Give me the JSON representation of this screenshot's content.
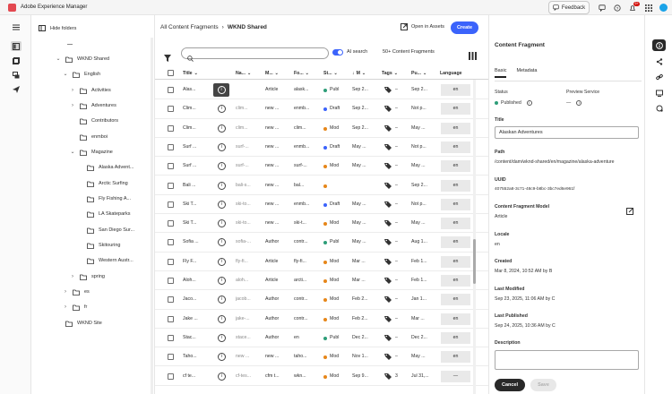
{
  "app": {
    "title": "Adobe Experience Manager",
    "notification_count": "9+"
  },
  "topbar": {
    "feedback_label": "Feedback"
  },
  "tree": {
    "hide_folders_label": "Hide folders",
    "items": [
      {
        "label": "WKND Shared",
        "chev": "⌄"
      },
      {
        "label": "English",
        "chev": "⌄"
      },
      {
        "label": "Activities",
        "chev": "›"
      },
      {
        "label": "Adventures",
        "chev": "›"
      },
      {
        "label": "Contributors",
        "chev": ""
      },
      {
        "label": "enmboi",
        "chev": ""
      },
      {
        "label": "Magazine",
        "chev": "⌄"
      },
      {
        "label": "Alaska Advent...",
        "chev": ""
      },
      {
        "label": "Arctic Surfing",
        "chev": ""
      },
      {
        "label": "Fly Fishing A...",
        "chev": ""
      },
      {
        "label": "LA Skateparks",
        "chev": ""
      },
      {
        "label": "San Diego Sur...",
        "chev": ""
      },
      {
        "label": "Skitouring",
        "chev": ""
      },
      {
        "label": "Western Austr...",
        "chev": ""
      },
      {
        "label": "spring",
        "chev": "›"
      },
      {
        "label": "es",
        "chev": "›"
      },
      {
        "label": "fr",
        "chev": "›"
      },
      {
        "label": "WKND Site",
        "chev": ""
      }
    ]
  },
  "breadcrumb": {
    "root": "All Content Fragments",
    "sep": "›",
    "current": "WKND Shared"
  },
  "toolbar": {
    "open_in_assets": "Open in Assets",
    "create": "Create",
    "ai_search": "AI search",
    "count": "50+ Content Fragments"
  },
  "table": {
    "headers": [
      "Title",
      "Na...",
      "M...",
      "Fo...",
      "St...",
      "M",
      "Tags",
      "Pu...",
      "Language"
    ],
    "rows": [
      {
        "title": "Alas...",
        "name": "",
        "model": "Article",
        "folder": "alask...",
        "status": "Publ",
        "status_color": "#2d9d78",
        "mod": "Sep 2...",
        "tags": "–",
        "pub": "Sep 2...",
        "lang": "en"
      },
      {
        "title": "Clim...",
        "name": "clim...",
        "model": "new ...",
        "folder": "enmb...",
        "status": "Draft",
        "status_color": "#3b63fb",
        "mod": "Sep 2...",
        "tags": "–",
        "pub": "Not p...",
        "lang": "en"
      },
      {
        "title": "Clim...",
        "name": "clim...",
        "model": "new ...",
        "folder": "clim...",
        "status": "Mod",
        "status_color": "#e68619",
        "mod": "Sep 2...",
        "tags": "–",
        "pub": "May ...",
        "lang": "en"
      },
      {
        "title": "Surf ...",
        "name": "surf-...",
        "model": "new ...",
        "folder": "enmb...",
        "status": "Draft",
        "status_color": "#3b63fb",
        "mod": "May ...",
        "tags": "–",
        "pub": "Not p...",
        "lang": "en"
      },
      {
        "title": "Surf ...",
        "name": "surf-...",
        "model": "new ...",
        "folder": "surf-...",
        "status": "Mod",
        "status_color": "#e68619",
        "mod": "May ...",
        "tags": "–",
        "pub": "May ...",
        "lang": "en"
      },
      {
        "title": "Bali ...",
        "name": "bali-s...",
        "model": "new ...",
        "folder": "bal...",
        "status": "",
        "status_color": "#e68619",
        "mod": "",
        "tags": "–",
        "pub": "Sep 2...",
        "lang": "en"
      },
      {
        "title": "Ski T...",
        "name": "ski-to...",
        "model": "new ...",
        "folder": "enmb...",
        "status": "Draft",
        "status_color": "#3b63fb",
        "mod": "May ...",
        "tags": "–",
        "pub": "Not p...",
        "lang": "en"
      },
      {
        "title": "Ski T...",
        "name": "ski-to...",
        "model": "new ...",
        "folder": "ski-t...",
        "status": "Mod",
        "status_color": "#e68619",
        "mod": "May ...",
        "tags": "–",
        "pub": "May ...",
        "lang": "en"
      },
      {
        "title": "Sofia ...",
        "name": "sofia-...",
        "model": "Author",
        "folder": "contr...",
        "status": "Publ",
        "status_color": "#2d9d78",
        "mod": "May ...",
        "tags": "–",
        "pub": "Aug 1...",
        "lang": "en"
      },
      {
        "title": "Fly F...",
        "name": "fly-fi...",
        "model": "Article",
        "folder": "fly-fi...",
        "status": "Mod",
        "status_color": "#e68619",
        "mod": "Mar ...",
        "tags": "–",
        "pub": "Feb 1...",
        "lang": "en"
      },
      {
        "title": "Aloh...",
        "name": "aloh...",
        "model": "Article",
        "folder": "arcti...",
        "status": "Mod",
        "status_color": "#e68619",
        "mod": "Mar ...",
        "tags": "–",
        "pub": "Feb 1...",
        "lang": "en"
      },
      {
        "title": "Jaco...",
        "name": "jacob...",
        "model": "Author",
        "folder": "contr...",
        "status": "Mod",
        "status_color": "#e68619",
        "mod": "Feb 2...",
        "tags": "–",
        "pub": "Jan 1...",
        "lang": "en"
      },
      {
        "title": "Jake ...",
        "name": "jake-...",
        "model": "Author",
        "folder": "contr...",
        "status": "Mod",
        "status_color": "#e68619",
        "mod": "Feb 2...",
        "tags": "–",
        "pub": "Mar ...",
        "lang": "en"
      },
      {
        "title": "Stac...",
        "name": "stace...",
        "model": "Author",
        "folder": "en",
        "status": "Publ",
        "status_color": "#2d9d78",
        "mod": "Dec 2...",
        "tags": "–",
        "pub": "Dec 2...",
        "lang": "en"
      },
      {
        "title": "Taho...",
        "name": "new ...",
        "model": "new ...",
        "folder": "taho...",
        "status": "Mod",
        "status_color": "#e68619",
        "mod": "Nov 1...",
        "tags": "–",
        "pub": "May ...",
        "lang": "en"
      },
      {
        "title": "cf te...",
        "name": "cf-tes...",
        "model": "cfm t...",
        "folder": "wkn...",
        "status": "Mod",
        "status_color": "#e68619",
        "mod": "Sep 9...",
        "tags": "3",
        "pub": "Jul 31,...",
        "lang": "—"
      }
    ]
  },
  "panel": {
    "title": "Content Fragment",
    "tabs": [
      "Basic",
      "Metadata"
    ],
    "status_label": "Status",
    "status_value": "Published",
    "preview_label": "Preview Service",
    "preview_value": "—",
    "title_label": "Title",
    "title_value": "Alaskan Adventures",
    "path_label": "Path",
    "path_value": "/content/dam/wknd-shared/en/magazine/alaska-adventure",
    "uuid_label": "UUID",
    "uuid_value": "407552a8-3c71-48c9-b8bc-3bc7ed6e961f",
    "model_label": "Content Fragment Model",
    "model_value": "Article",
    "locale_label": "Locale",
    "locale_value": "en",
    "created_label": "Created",
    "created_value": "Mar 8, 2024, 10:52 AM by B",
    "modified_label": "Last Modified",
    "modified_value": "Sep 23, 2025, 11:06 AM by C",
    "published_label": "Last Published",
    "published_value": "Sep 24, 2025, 10:36 AM by C",
    "description_label": "Description",
    "cancel": "Cancel",
    "save": "Save"
  },
  "colors": {
    "accent": "#3b63fb",
    "published": "#2d9d78",
    "modified": "#e68619",
    "draft": "#3b63fb"
  }
}
